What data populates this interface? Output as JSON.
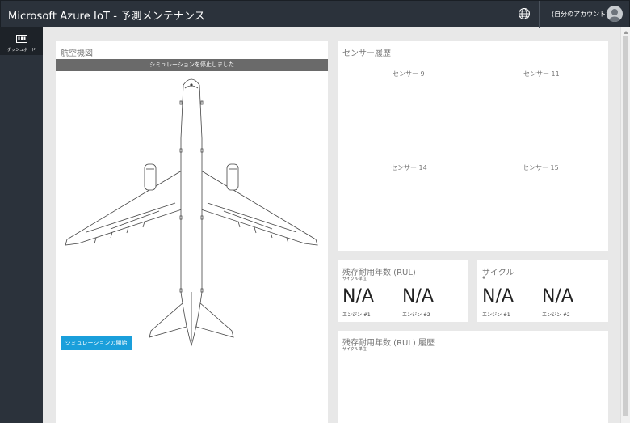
{
  "header": {
    "app_title": "Microsoft Azure IoT - 予測メンテナンス",
    "account_name": "(自分のアカウント名)",
    "globe_icon": "globe-icon",
    "avatar_icon": "user-avatar-icon"
  },
  "sidebar": {
    "items": [
      {
        "label": "ダッシュボード",
        "icon": "dashboard-icon"
      }
    ]
  },
  "aircraft_panel": {
    "title": "航空機図",
    "status_banner": "シミュレーションを停止しました",
    "start_button": "シミュレーションの開始"
  },
  "sensor_panel": {
    "title": "センサー履歴",
    "sensors": [
      "センサー 9",
      "センサー 11",
      "センサー 14",
      "センサー 15"
    ]
  },
  "rul_panel": {
    "title": "残存耐用年数 (RUL)",
    "subtitle": "サイクル単位",
    "values": [
      {
        "value": "N/A",
        "engine": "エンジン #1"
      },
      {
        "value": "N/A",
        "engine": "エンジン #2"
      }
    ]
  },
  "cycle_panel": {
    "title": "サイクル",
    "subtitle": "#",
    "values": [
      {
        "value": "N/A",
        "engine": "エンジン #1"
      },
      {
        "value": "N/A",
        "engine": "エンジン #2"
      }
    ]
  },
  "rul_history_panel": {
    "title": "残存耐用年数 (RUL) 履歴",
    "subtitle": "サイクル単位"
  }
}
